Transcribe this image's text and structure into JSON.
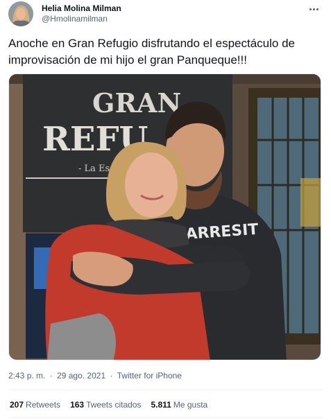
{
  "author": {
    "display_name": "Helia Molina Milman",
    "handle": "@Hmolinamilman"
  },
  "tweet": {
    "text": "Anoche en Gran Refugio disfrutando el espectáculo de improvisación de mi hijo el gran Panqueque!!!"
  },
  "media": {
    "sign_line1": "GRAN",
    "sign_line2": "REFU",
    "sign_line3": "- La Esquina",
    "shirt_text": "ARRESIT"
  },
  "meta": {
    "time": "2:43 p. m.",
    "separator": "·",
    "date": "29 ago. 2021",
    "source": "Twitter for iPhone"
  },
  "stats": {
    "retweets_count": "207",
    "retweets_label": "Retweets",
    "quotes_count": "163",
    "quotes_label": "Tweets citados",
    "likes_count": "5.811",
    "likes_label": "Me gusta"
  },
  "icons": {
    "more": "more-dots-icon"
  }
}
